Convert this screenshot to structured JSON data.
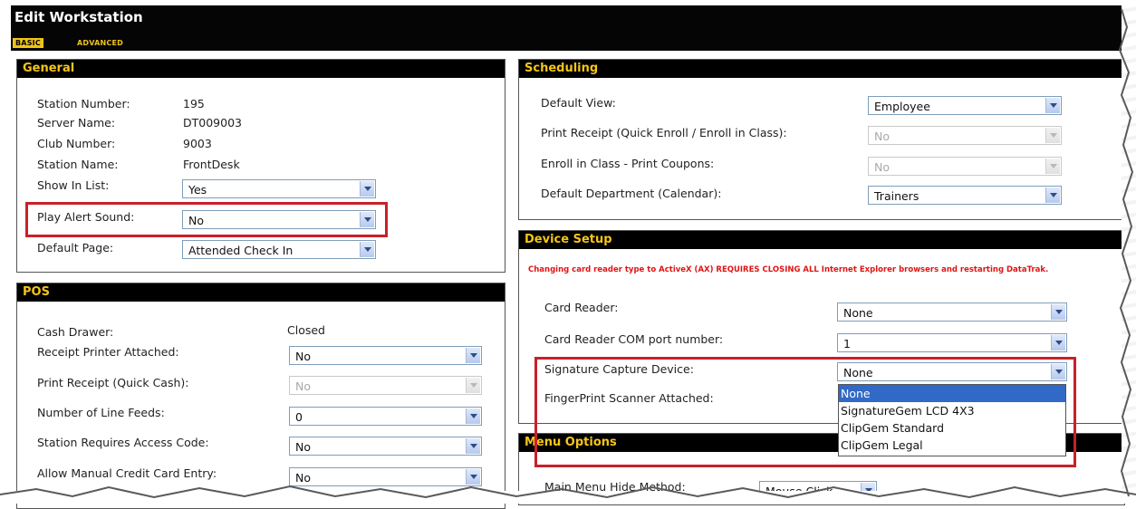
{
  "window": {
    "title": "Edit Workstation"
  },
  "tabs": [
    {
      "label": "Basic",
      "active": true
    },
    {
      "label": "Advanced",
      "active": false
    }
  ],
  "general": {
    "title": "General",
    "station_number": {
      "label": "Station Number:",
      "value": "195"
    },
    "server_name": {
      "label": "Server Name:",
      "value": "DT009003"
    },
    "club_number": {
      "label": "Club Number:",
      "value": "9003"
    },
    "station_name": {
      "label": "Station Name:",
      "value": "FrontDesk"
    },
    "show_in_list": {
      "label": "Show In List:",
      "value": "Yes"
    },
    "play_alert_sound": {
      "label": "Play Alert Sound:",
      "value": "No"
    },
    "default_page": {
      "label": "Default Page:",
      "value": "Attended Check In"
    }
  },
  "pos": {
    "title": "POS",
    "cash_drawer": {
      "label": "Cash Drawer:",
      "value": "Closed"
    },
    "receipt_printer": {
      "label": "Receipt Printer Attached:",
      "value": "No"
    },
    "print_receipt": {
      "label": "Print Receipt (Quick Cash):",
      "value": "No"
    },
    "line_feeds": {
      "label": "Number of Line Feeds:",
      "value": "0"
    },
    "access_code": {
      "label": "Station Requires Access Code:",
      "value": "No"
    },
    "manual_credit": {
      "label": "Allow Manual Credit Card Entry:",
      "value": "No"
    }
  },
  "scheduling": {
    "title": "Scheduling",
    "default_view": {
      "label": "Default View:",
      "value": "Employee"
    },
    "print_receipt": {
      "label": "Print Receipt (Quick Enroll / Enroll in Class):",
      "value": "No"
    },
    "print_coupons": {
      "label": "Enroll in Class - Print Coupons:",
      "value": "No"
    },
    "default_department": {
      "label": "Default Department (Calendar):",
      "value": "Trainers"
    }
  },
  "device_setup": {
    "title": "Device Setup",
    "warning": "Changing card reader type to ActiveX (AX) REQUIRES CLOSING ALL Internet Explorer browsers and restarting DataTrak.",
    "card_reader": {
      "label": "Card Reader:",
      "value": "None"
    },
    "com_port": {
      "label": "Card Reader COM port number:",
      "value": "1"
    },
    "signature": {
      "label": "Signature Capture Device:",
      "value": "None",
      "options": [
        "None",
        "SignatureGem LCD 4X3",
        "ClipGem Standard",
        "ClipGem Legal"
      ]
    },
    "fingerprint": {
      "label": "FingerPrint Scanner Attached:"
    }
  },
  "menu_options": {
    "title": "Menu Options",
    "hide_method": {
      "label": "Main Menu Hide Method:",
      "value": "Mouse Click"
    }
  },
  "colors": {
    "header_bg": "#000000",
    "header_text": "#f5c518",
    "warning_text": "#e01414",
    "highlight_border": "#c8202a",
    "selected_option": "#3169c6"
  }
}
